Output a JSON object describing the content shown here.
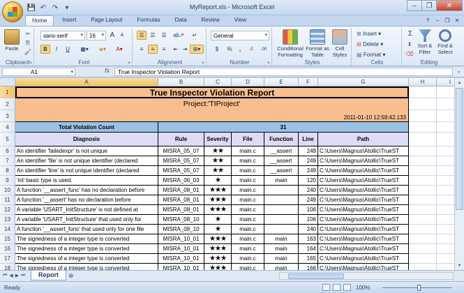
{
  "window": {
    "title": "MyReport.xls - Microsoft Excel"
  },
  "qat": [
    "💾",
    "↶",
    "↷",
    "▾"
  ],
  "tabs": [
    "Home",
    "Insert",
    "Page Layout",
    "Formulas",
    "Data",
    "Review",
    "View"
  ],
  "ribbon": {
    "clipboard": {
      "label": "Clipboard",
      "paste": "Paste"
    },
    "font": {
      "label": "Font",
      "name": "sans-serif",
      "size": "16",
      "bold": "B",
      "italic": "I",
      "underline": "U",
      "grow": "A",
      "shrink": "A"
    },
    "alignment": {
      "label": "Alignment"
    },
    "number": {
      "label": "Number",
      "format": "General",
      "currency": "$",
      "percent": "%",
      "comma": ",",
      "inc": ".0",
      "dec": ".00"
    },
    "styles": {
      "label": "Styles",
      "conditional": "Conditional Formatting",
      "format_table": "Format as Table",
      "cell_styles": "Cell Styles"
    },
    "cells": {
      "label": "Cells",
      "insert": "Insert",
      "delete": "Delete",
      "format": "Format"
    },
    "editing": {
      "label": "Editing",
      "sigma": "Σ",
      "sort": "Sort & Filter",
      "find": "Find & Select"
    }
  },
  "formula_bar": {
    "name_box": "A1",
    "fx": "fx",
    "content": "True Inspector Violation Report"
  },
  "columns": [
    "A",
    "B",
    "C",
    "D",
    "E",
    "F",
    "G",
    "H",
    "I",
    "J"
  ],
  "rows": [
    "1",
    "2",
    "3",
    "4",
    "5",
    "6",
    "7",
    "8",
    "9",
    "10",
    "11",
    "12",
    "13",
    "14",
    "15",
    "16",
    "17",
    "18",
    "19"
  ],
  "report": {
    "title": "True Inspector Violation Report",
    "project": "Project:'TIProject'",
    "timestamp": "2011-01-10 12:59:42.133",
    "total_label": "Total Violation Count",
    "total_value": "31",
    "headers": [
      "Diagnosis",
      "Rule",
      "Severity",
      "File",
      "Function",
      "Line",
      "Path"
    ],
    "rows": [
      [
        "An identifier 'failedexpr' is not unique",
        "MISRA_05_07",
        "★★",
        "main.c",
        "__assert",
        "249",
        "C:\\Users\\Magnus\\Atollic\\TrueST"
      ],
      [
        "An identifier 'file' is not unique identifier (declared",
        "MISRA_05_07",
        "★★",
        "main.c",
        "__assert",
        "249",
        "C:\\Users\\Magnus\\Atollic\\TrueST"
      ],
      [
        "An identifier 'line' is not unique identifier (declared",
        "MISRA_05_07",
        "★★",
        "main.c",
        "__assert",
        "249",
        "C:\\Users\\Magnus\\Atollic\\TrueST"
      ],
      [
        "'int' basic type is used.",
        "MISRA_06_03",
        "★",
        "main.c",
        "main",
        "120",
        "C:\\Users\\Magnus\\Atollic\\TrueST"
      ],
      [
        "A function '__assert_func' has no declaration before",
        "MISRA_08_01",
        "★★★",
        "main.c",
        "",
        "240",
        "C:\\Users\\Magnus\\Atollic\\TrueST"
      ],
      [
        "A function '__assert' has no declaration before",
        "MISRA_08_01",
        "★★★",
        "main.c",
        "",
        "249",
        "C:\\Users\\Magnus\\Atollic\\TrueST"
      ],
      [
        "A variable 'USART_InitStructure' is not defined at",
        "MISRA_08_01",
        "★★★",
        "main.c",
        "",
        "106",
        "C:\\Users\\Magnus\\Atollic\\TrueST"
      ],
      [
        "A variable 'USART_InitStructure' that used only for",
        "MISRA_08_10",
        "★",
        "main.c",
        "",
        "106",
        "C:\\Users\\Magnus\\Atollic\\TrueST"
      ],
      [
        "A function '__assert_func' that used only for one file",
        "MISRA_08_10",
        "★",
        "main.c",
        "",
        "240",
        "C:\\Users\\Magnus\\Atollic\\TrueST"
      ],
      [
        "The signedness of a integer type is converted",
        "MISRA_10_01",
        "★★★",
        "main.c",
        "main",
        "163",
        "C:\\Users\\Magnus\\Atollic\\TrueST"
      ],
      [
        "The signedness of a integer type is converted",
        "MISRA_10_01",
        "★★★",
        "main.c",
        "main",
        "164",
        "C:\\Users\\Magnus\\Atollic\\TrueST"
      ],
      [
        "The signedness of a integer type is converted",
        "MISRA_10_01",
        "★★★",
        "main.c",
        "main",
        "165",
        "C:\\Users\\Magnus\\Atollic\\TrueST"
      ],
      [
        "The signedness of a integer type is converted",
        "MISRA_10_01",
        "★★★",
        "main.c",
        "main",
        "166",
        "C:\\Users\\Magnus\\Atollic\\TrueST"
      ]
    ]
  },
  "sheet": {
    "tab": "Report"
  },
  "status": {
    "ready": "Ready",
    "zoom": "100%"
  },
  "colors": {
    "orange": "#f9be8f",
    "blue": "#9bc1e6",
    "lavender": "#dcdcf6"
  }
}
